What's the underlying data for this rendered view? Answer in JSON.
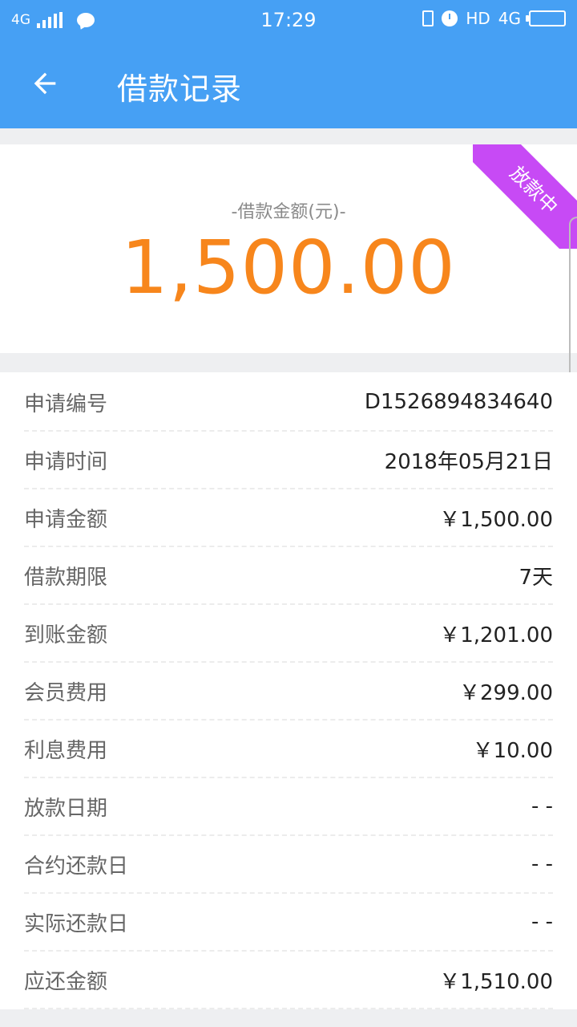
{
  "status_bar": {
    "network_left": "4G",
    "time": "17:29",
    "hd": "HD",
    "network_right": "4G"
  },
  "header": {
    "title": "借款记录",
    "back_icon": "back-arrow-icon"
  },
  "summary": {
    "label": "-借款金额(元)-",
    "amount": "1,500.00",
    "status_ribbon": "放款中",
    "amount_color": "#f7861c",
    "ribbon_color": "#c74af5"
  },
  "details": [
    {
      "label": "申请编号",
      "value": "D1526894834640"
    },
    {
      "label": "申请时间",
      "value": "2018年05月21日"
    },
    {
      "label": "申请金额",
      "value": "￥1,500.00"
    },
    {
      "label": "借款期限",
      "value": "7天"
    },
    {
      "label": "到账金额",
      "value": "￥1,201.00"
    },
    {
      "label": "会员费用",
      "value": "￥299.00"
    },
    {
      "label": "利息费用",
      "value": "￥10.00"
    },
    {
      "label": "放款日期",
      "value": "- -"
    },
    {
      "label": "合约还款日",
      "value": "- -"
    },
    {
      "label": "实际还款日",
      "value": "- -"
    },
    {
      "label": "应还金额",
      "value": "￥1,510.00"
    }
  ],
  "theme": {
    "primary": "#46a0f4"
  }
}
